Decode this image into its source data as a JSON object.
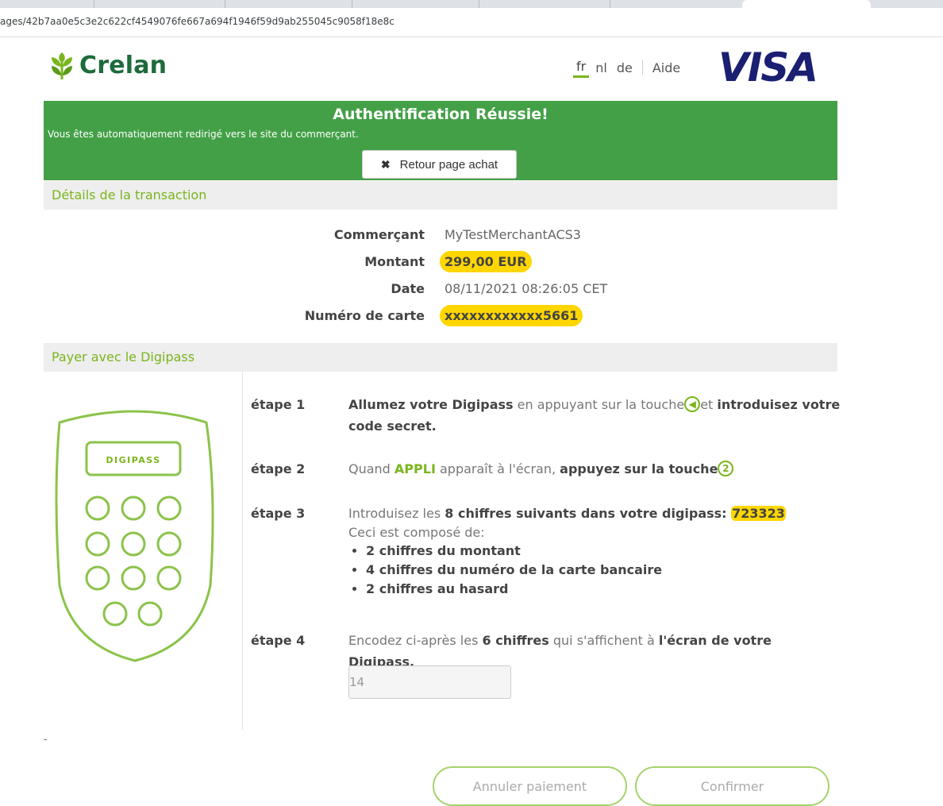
{
  "browser": {
    "url": "ages/42b7aa0e5c3e2c622cf4549076fe667a694f1946f59d9ab255045c9058f18e8c"
  },
  "header": {
    "brand": "Crelan",
    "languages": [
      "fr",
      "nl",
      "de"
    ],
    "active_language": "fr",
    "help_label": "Aide",
    "card_brand": "VISA"
  },
  "banner": {
    "title": "Authentification Réussie!",
    "subtitle": "Vous êtes automatiquement redirigé vers le site du commerçant.",
    "return_button": "Retour page achat"
  },
  "transaction": {
    "section_title": "Détails de la transaction",
    "rows": [
      {
        "label": "Commerçant",
        "value": "MyTestMerchantACS3"
      },
      {
        "label": "Montant",
        "value": "299,00 EUR"
      },
      {
        "label": "Date",
        "value": "08/11/2021 08:26:05 CET"
      },
      {
        "label": "Numéro de carte",
        "value": "xxxxxxxxxxxx5661"
      }
    ]
  },
  "digipass": {
    "section_title": "Payer avec le Digipass",
    "device_label": "DIGIPASS",
    "steps": [
      {
        "label": "étape 1",
        "part1_bold": "Allumez votre Digipass",
        "part2": " en appuyant sur la touche",
        "key_icon": "◀",
        "part3": "et ",
        "part4_bold": "introduisez votre code secret."
      },
      {
        "label": "étape 2",
        "part1": "Quand ",
        "green_word": "APPLI",
        "part2": " apparaît à l'écran, ",
        "part3_bold": "appuyez sur la touche",
        "key_icon": "2"
      },
      {
        "label": "étape 3",
        "part1": "Introduisez les ",
        "part2_bold": "8 chiffres suivants dans votre digipass: ",
        "code": "723323",
        "line2": "Ceci est composé de:",
        "bullets": [
          "2 chiffres du montant",
          "4 chiffres du numéro de la carte bancaire",
          "2 chiffres au hasard"
        ]
      },
      {
        "label": "étape 4",
        "part1": "Encodez ci-après les ",
        "part2_bold": "6 chiffres",
        "part3": " qui s'affichent à ",
        "part4_bold": "l'écran de votre Digipass."
      }
    ],
    "input_value": "14"
  },
  "footer": {
    "dash": "-",
    "cancel_button": "Annuler paiement",
    "confirm_button": "Confirmer"
  },
  "colors": {
    "brand_green": "#1d6b3b",
    "accent_green": "#7ab51d",
    "success_green": "#43a047",
    "highlight_yellow": "#ffd600",
    "visa_blue": "#1a1f71"
  }
}
